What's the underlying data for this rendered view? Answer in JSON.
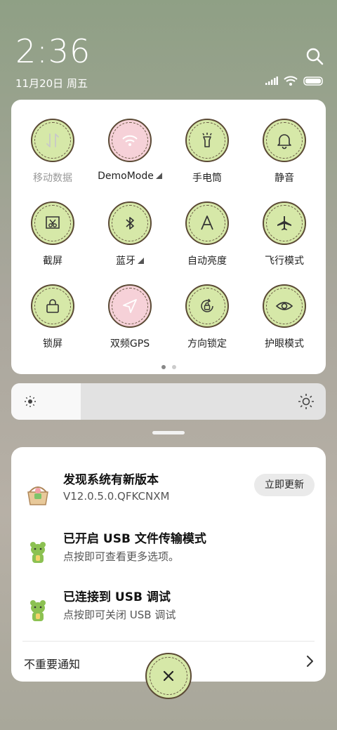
{
  "status": {
    "time": "2:36",
    "date": "11月20日 周五"
  },
  "quick_settings": {
    "tiles": [
      {
        "label": "移动数据",
        "icon": "mobile-data-icon",
        "state": "disabled"
      },
      {
        "label": "DemoMode",
        "icon": "wifi-icon",
        "state": "pink",
        "has_more": true
      },
      {
        "label": "手电筒",
        "icon": "flashlight-icon"
      },
      {
        "label": "静音",
        "icon": "bell-icon"
      },
      {
        "label": "截屏",
        "icon": "screenshot-icon"
      },
      {
        "label": "蓝牙",
        "icon": "bluetooth-icon",
        "has_more": true
      },
      {
        "label": "自动亮度",
        "icon": "auto-brightness-icon"
      },
      {
        "label": "飞行模式",
        "icon": "airplane-icon"
      },
      {
        "label": "锁屏",
        "icon": "lock-icon"
      },
      {
        "label": "双频GPS",
        "icon": "gps-icon",
        "state": "pink"
      },
      {
        "label": "方向锁定",
        "icon": "rotation-lock-icon"
      },
      {
        "label": "护眼模式",
        "icon": "eye-icon"
      }
    ],
    "page_count": 2,
    "active_page": 1
  },
  "brightness": {
    "level": 0.22
  },
  "notifications": [
    {
      "title": "发现系统有新版本",
      "body": "V12.0.5.0.QFKCNXM",
      "action": "立即更新",
      "icon": "update-basket-icon"
    },
    {
      "title": "已开启 USB 文件传输模式",
      "body": "点按即可查看更多选项。",
      "icon": "android-bear-icon"
    },
    {
      "title": "已连接到 USB 调试",
      "body": "点按即可关闭 USB 调试",
      "icon": "android-bear-icon"
    }
  ],
  "minor_notifications_label": "不重要通知",
  "colors": {
    "tile_green": "#d6e8a8",
    "tile_pink": "#f6d1d8",
    "tile_border": "#5b4a35"
  }
}
